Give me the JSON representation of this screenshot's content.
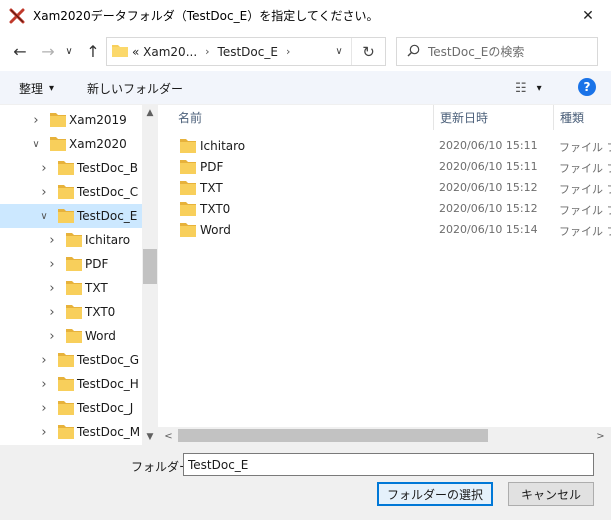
{
  "window": {
    "title": "Xam2020データフォルダ（TestDoc_E）を指定してください。",
    "close_glyph": "✕",
    "accent": "#0078d7",
    "icon": "app-x-icon"
  },
  "nav": {
    "back_glyph": "←",
    "forward_glyph": "→",
    "dropdown_glyph": "∨",
    "up_glyph": "↑",
    "address": {
      "crumbs": [
        "« Xam20...",
        "TestDoc_E"
      ],
      "separator": "›",
      "refresh_glyph": "↻"
    },
    "search": {
      "placeholder": "TestDoc_Eの検索"
    }
  },
  "toolbar": {
    "organize_label": "整理",
    "organize_caret": "▾",
    "new_folder_label": "新しいフォルダー",
    "view_glyph": "☷",
    "view_caret": "▾",
    "help_label": "?"
  },
  "tree": {
    "items": [
      {
        "label": "Xam2019",
        "chevron": "›",
        "expanded": false,
        "selected": false
      },
      {
        "label": "Xam2020",
        "chevron": "∨",
        "expanded": true,
        "selected": false
      },
      {
        "label": "TestDoc_B",
        "chevron": "›",
        "expanded": false,
        "selected": false
      },
      {
        "label": "TestDoc_C",
        "chevron": "›",
        "expanded": false,
        "selected": false
      },
      {
        "label": "TestDoc_E",
        "chevron": "∨",
        "expanded": true,
        "selected": true
      },
      {
        "label": "Ichitaro",
        "chevron": "›",
        "expanded": false,
        "selected": false
      },
      {
        "label": "PDF",
        "chevron": "›",
        "expanded": false,
        "selected": false
      },
      {
        "label": "TXT",
        "chevron": "›",
        "expanded": false,
        "selected": false
      },
      {
        "label": "TXT0",
        "chevron": "›",
        "expanded": false,
        "selected": false
      },
      {
        "label": "Word",
        "chevron": "›",
        "expanded": false,
        "selected": false
      },
      {
        "label": "TestDoc_G",
        "chevron": "›",
        "expanded": false,
        "selected": false
      },
      {
        "label": "TestDoc_H",
        "chevron": "›",
        "expanded": false,
        "selected": false
      },
      {
        "label": "TestDoc_J",
        "chevron": "›",
        "expanded": false,
        "selected": false
      },
      {
        "label": "TestDoc_M",
        "chevron": "›",
        "expanded": false,
        "selected": false
      }
    ],
    "scroll_up_glyph": "▲",
    "scroll_down_glyph": "▼"
  },
  "list": {
    "columns": [
      "名前",
      "更新日時",
      "種類"
    ],
    "sort_glyph": "^",
    "rows": [
      {
        "name": "Ichitaro",
        "date": "2020/06/10 15:11",
        "type": "ファイル フォ"
      },
      {
        "name": "PDF",
        "date": "2020/06/10 15:11",
        "type": "ファイル フォ"
      },
      {
        "name": "TXT",
        "date": "2020/06/10 15:12",
        "type": "ファイル フォ"
      },
      {
        "name": "TXT0",
        "date": "2020/06/10 15:12",
        "type": "ファイル フォ"
      },
      {
        "name": "Word",
        "date": "2020/06/10 15:14",
        "type": "ファイル フォ"
      }
    ],
    "hscroll_left_glyph": "<",
    "hscroll_right_glyph": ">"
  },
  "footer": {
    "folder_label": "フォルダー:",
    "folder_value": "TestDoc_E",
    "select_label": "フォルダーの選択",
    "cancel_label": "キャンセル"
  },
  "colors": {
    "folder": "#f8cf5b",
    "folder_dark": "#e7b23b",
    "selected_bg": "#cce8ff",
    "help_blue": "#1a73e8"
  }
}
